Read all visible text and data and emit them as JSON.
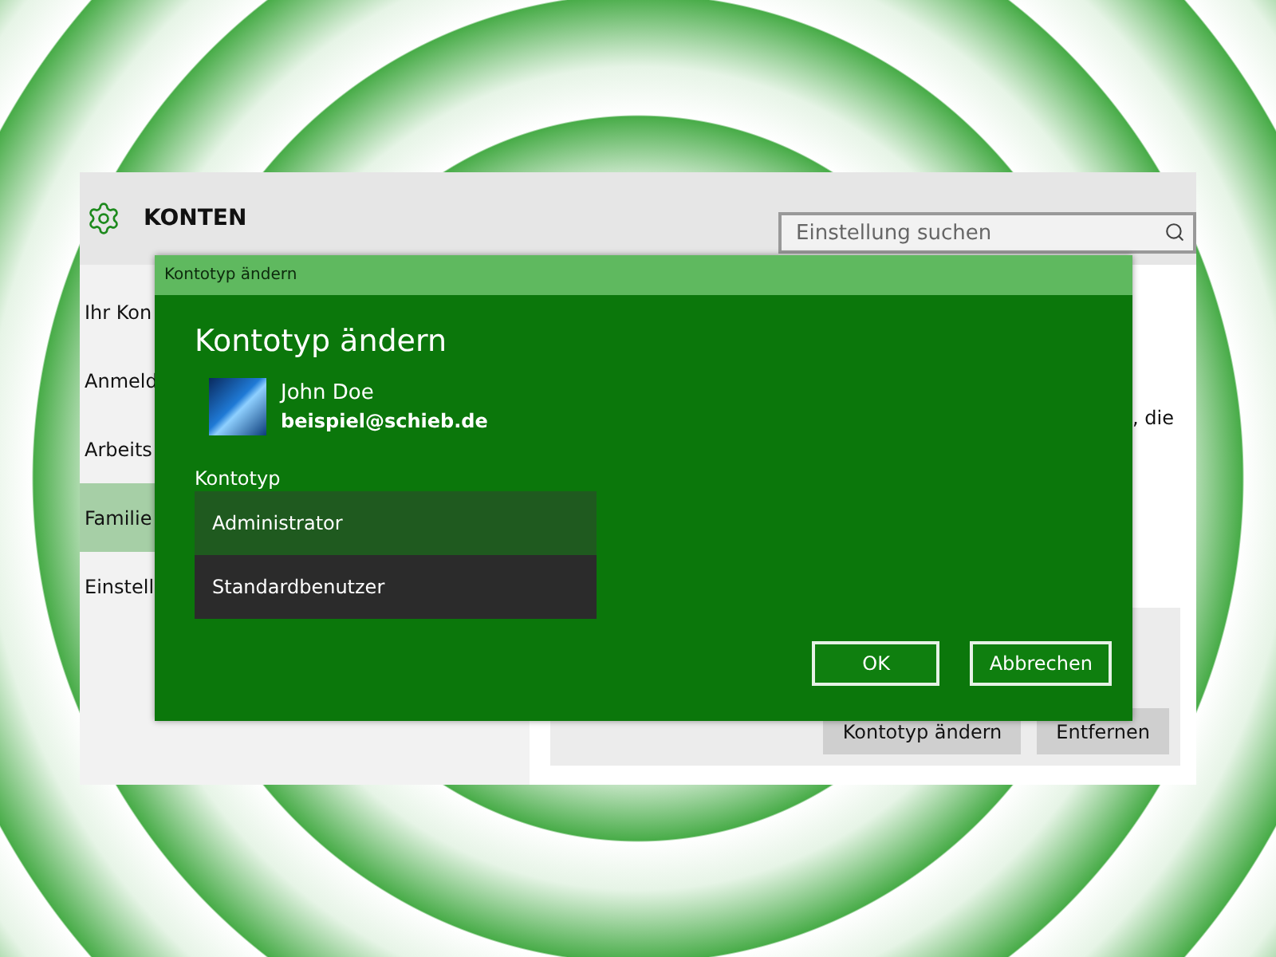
{
  "window": {
    "section_title": "KONTEN",
    "search": {
      "placeholder": "Einstellung suchen"
    }
  },
  "sidebar": {
    "items": [
      {
        "label": "Ihr Kon",
        "selected": false
      },
      {
        "label": "Anmeld",
        "selected": false
      },
      {
        "label": "Arbeits",
        "selected": false
      },
      {
        "label": "Familie",
        "selected": true
      },
      {
        "label": "Einstell",
        "selected": false
      }
    ]
  },
  "content": {
    "text_fragment": ", die",
    "buttons": [
      "Kontotyp ändern",
      "Entfernen"
    ]
  },
  "dialog": {
    "titlebar": "Kontotyp ändern",
    "heading": "Kontotyp ändern",
    "user": {
      "name": "John Doe",
      "email": "beispiel@schieb.de"
    },
    "field_label": "Kontotyp",
    "options": [
      {
        "label": "Administrator",
        "selected": true
      },
      {
        "label": "Standardbenutzer",
        "selected": false
      }
    ],
    "buttons": [
      "OK",
      "Abbrechen"
    ]
  }
}
